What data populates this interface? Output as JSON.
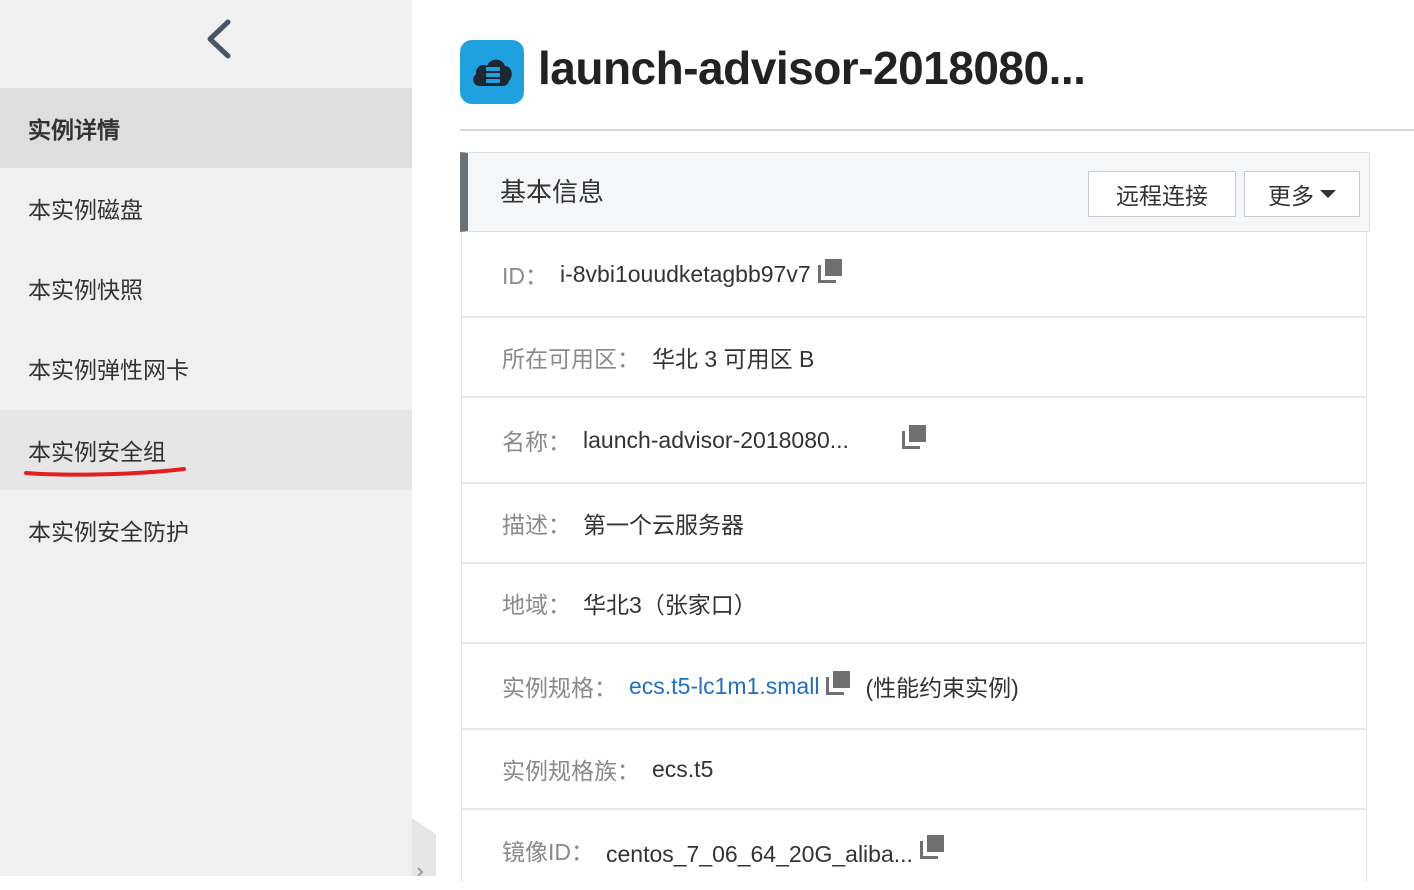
{
  "sidebar": {
    "back_icon": "chevron-left-icon",
    "items": [
      {
        "label": "实例详情",
        "state": "active"
      },
      {
        "label": "本实例磁盘"
      },
      {
        "label": "本实例快照"
      },
      {
        "label": "本实例弹性网卡"
      },
      {
        "label": "本实例安全组",
        "state": "hover"
      },
      {
        "label": "本实例安全防护"
      }
    ],
    "annotation_color": "#e02020"
  },
  "header": {
    "icon": "cloud-server-icon",
    "title": "launch-advisor-2018080..."
  },
  "panel": {
    "title": "基本信息",
    "remote_button": "远程连接",
    "more_button": "更多"
  },
  "info": {
    "id": {
      "label": "ID：",
      "value": "i-8vbi1ouudketagbb97v7"
    },
    "zone": {
      "label": "所在可用区：",
      "value": "华北 3 可用区 B"
    },
    "name": {
      "label": "名称：",
      "value": "launch-advisor-2018080..."
    },
    "description": {
      "label": "描述：",
      "value": "第一个云服务器"
    },
    "region": {
      "label": "地域：",
      "value": "华北3（张家口）"
    },
    "spec": {
      "label": "实例规格：",
      "value": "ecs.t5-lc1m1.small",
      "note": "(性能约束实例)"
    },
    "spec_family": {
      "label": "实例规格族：",
      "value": "ecs.t5"
    },
    "image_id": {
      "label": "镜像ID：",
      "value": "centos_7_06_64_20G_aliba..."
    }
  },
  "colors": {
    "link": "#1f6fc4",
    "brand_icon": "#1fa0df",
    "panel_accent": "#69707a"
  }
}
